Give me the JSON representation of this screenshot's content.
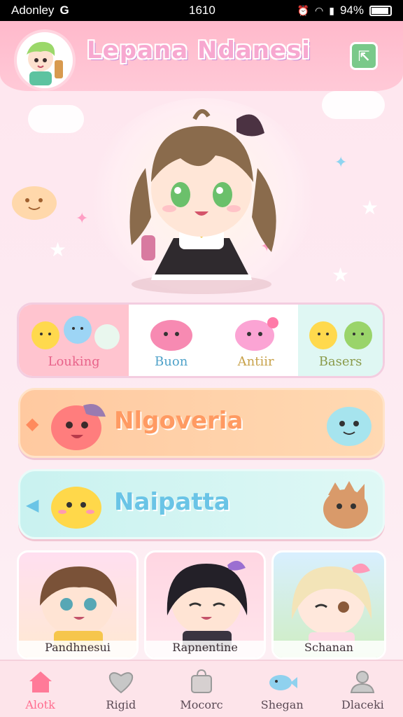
{
  "status_bar": {
    "carrier": "Adonley",
    "carrier_icon": "G",
    "time": "1610",
    "battery": "94%"
  },
  "header": {
    "title": "Lepana Ndanesi"
  },
  "categories": [
    {
      "label": "Louking"
    },
    {
      "label": "Buon"
    },
    {
      "label": "Antiir"
    },
    {
      "label": "Basers"
    }
  ],
  "big_buttons": [
    {
      "label": "Nlgoveria"
    },
    {
      "label": "Naipatta"
    }
  ],
  "cards": [
    {
      "label": "Pandhnesui"
    },
    {
      "label": "Rapnentine"
    },
    {
      "label": "Schanan"
    }
  ],
  "nav": [
    {
      "label": "Alotk",
      "icon": "home-icon",
      "active": true
    },
    {
      "label": "Rigid",
      "icon": "heart-icon"
    },
    {
      "label": "Mocorc",
      "icon": "bag-icon"
    },
    {
      "label": "Shegan",
      "icon": "fish-icon"
    },
    {
      "label": "Dlaceki",
      "icon": "profile-icon"
    }
  ],
  "colors": {
    "accent_pink": "#ff6d8f",
    "header_pink": "#ffb9cb",
    "orange_button": "#ffc9a0",
    "teal_button": "#c9f2f0"
  }
}
